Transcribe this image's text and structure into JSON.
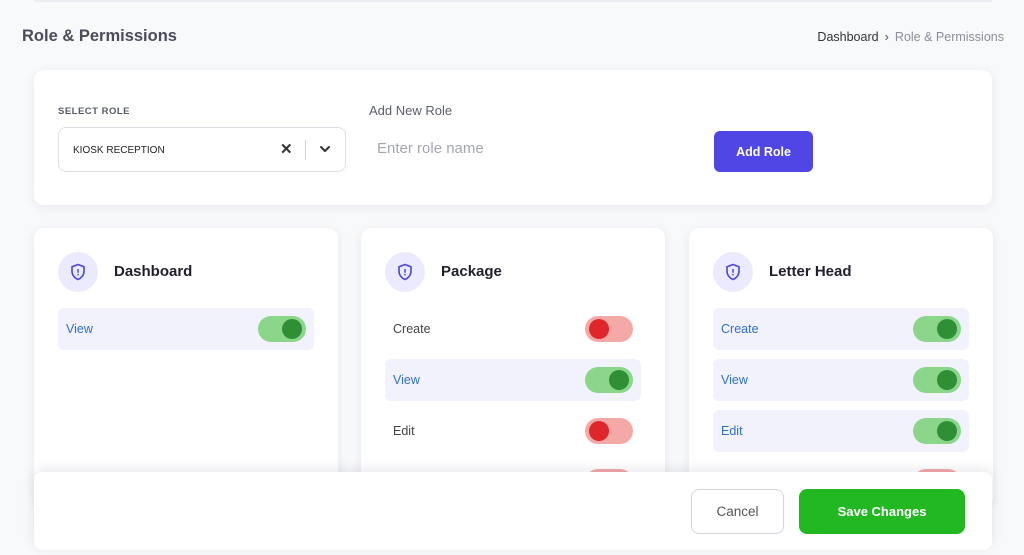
{
  "page": {
    "title": "Role & Permissions"
  },
  "breadcrumb": {
    "items": [
      "Dashboard",
      "Role & Permissions"
    ],
    "separator": "›"
  },
  "role_form": {
    "select_label": "SELECT ROLE",
    "selected_role": "KIOSK RECEPTION",
    "clear_icon": "close-icon",
    "dropdown_icon": "chevron-down-icon",
    "new_role_label": "Add New Role",
    "new_role_placeholder": "Enter role name",
    "new_role_value": "",
    "add_button": "Add Role"
  },
  "permission_groups": [
    {
      "title": "Dashboard",
      "icon": "shield-icon",
      "permissions": [
        {
          "label": "View",
          "enabled": true
        }
      ]
    },
    {
      "title": "Package",
      "icon": "shield-icon",
      "permissions": [
        {
          "label": "Create",
          "enabled": false
        },
        {
          "label": "View",
          "enabled": true
        },
        {
          "label": "Edit",
          "enabled": false
        },
        {
          "label": "",
          "enabled": false
        }
      ]
    },
    {
      "title": "Letter Head",
      "icon": "shield-icon",
      "permissions": [
        {
          "label": "Create",
          "enabled": true
        },
        {
          "label": "View",
          "enabled": true
        },
        {
          "label": "Edit",
          "enabled": true
        },
        {
          "label": "",
          "enabled": false
        }
      ]
    }
  ],
  "footer": {
    "cancel": "Cancel",
    "save": "Save Changes"
  },
  "colors": {
    "accent": "#4f46e5",
    "save": "#22b822",
    "toggle_on": "#8bd68b",
    "knob_on": "#2f8f34",
    "toggle_off": "#f4a8a8",
    "knob_off": "#e0262a"
  }
}
